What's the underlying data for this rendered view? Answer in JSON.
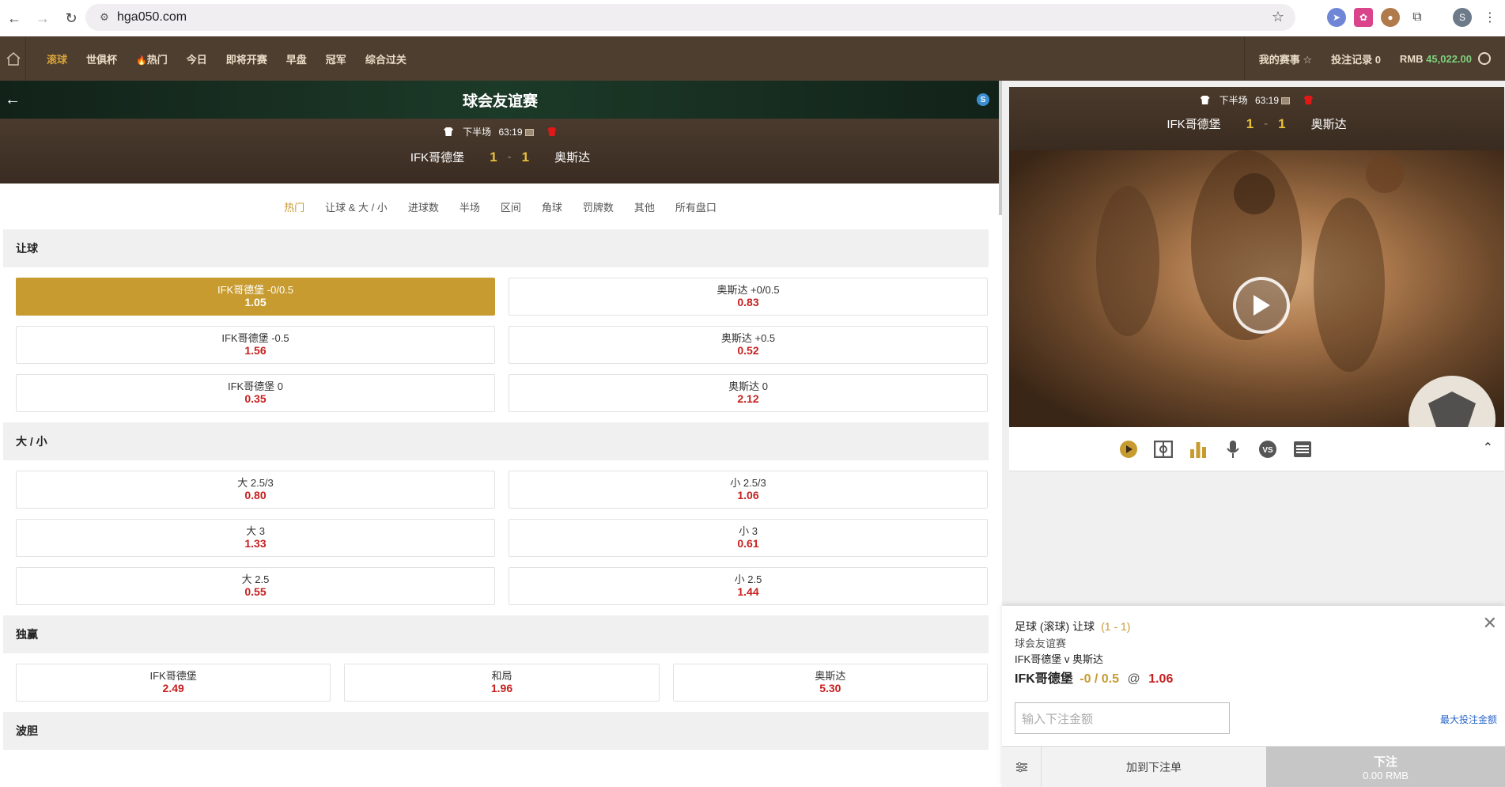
{
  "browser": {
    "url": "hga050.com",
    "profile_initial": "S"
  },
  "header": {
    "tabs": [
      {
        "label": "滚球",
        "active": true
      },
      {
        "label": "世俱杯"
      },
      {
        "label": "热门"
      },
      {
        "label": "今日"
      },
      {
        "label": "即将开赛"
      },
      {
        "label": "早盘"
      },
      {
        "label": "冠军"
      },
      {
        "label": "综合过关"
      }
    ],
    "my_events": "我的赛事",
    "bet_record": "投注记录 0",
    "currency": "RMB",
    "balance": "45,022.00"
  },
  "match": {
    "league": "球会友谊赛",
    "status": "下半场",
    "time": "63:19",
    "home": "IFK哥德堡",
    "away": "奥斯达",
    "home_score": "1",
    "away_score": "1",
    "separator": "-",
    "badge": "S"
  },
  "market_tabs": [
    "热门",
    "让球 & 大 / 小",
    "进球数",
    "半场",
    "区间",
    "角球",
    "罚牌数",
    "其他",
    "所有盘口"
  ],
  "sections": {
    "handicap": {
      "title": "让球",
      "rows": [
        [
          {
            "label": "IFK哥德堡 -0/0.5",
            "odds": "1.05",
            "selected": true
          },
          {
            "label": "奥斯达 +0/0.5",
            "odds": "0.83"
          }
        ],
        [
          {
            "label": "IFK哥德堡 -0.5",
            "odds": "1.56"
          },
          {
            "label": "奥斯达 +0.5",
            "odds": "0.52"
          }
        ],
        [
          {
            "label": "IFK哥德堡 0",
            "odds": "0.35"
          },
          {
            "label": "奥斯达 0",
            "odds": "2.12"
          }
        ]
      ]
    },
    "over_under": {
      "title": "大 / 小",
      "rows": [
        [
          {
            "label": "大 2.5/3",
            "odds": "0.80"
          },
          {
            "label": "小 2.5/3",
            "odds": "1.06"
          }
        ],
        [
          {
            "label": "大 3",
            "odds": "1.33"
          },
          {
            "label": "小 3",
            "odds": "0.61"
          }
        ],
        [
          {
            "label": "大 2.5",
            "odds": "0.55"
          },
          {
            "label": "小 2.5",
            "odds": "1.44"
          }
        ]
      ]
    },
    "moneyline": {
      "title": "独赢",
      "items": [
        {
          "label": "IFK哥德堡",
          "odds": "2.49"
        },
        {
          "label": "和局",
          "odds": "1.96"
        },
        {
          "label": "奥斯达",
          "odds": "5.30"
        }
      ]
    },
    "correct_score": {
      "title": "波胆"
    }
  },
  "bet_slip": {
    "market": "足球 (滚球) 让球",
    "score": "(1 - 1)",
    "league": "球会友谊赛",
    "fixture": "IFK哥德堡 v 奥斯达",
    "pick_team": "IFK哥德堡",
    "pick_handicap": "-0 / 0.5",
    "at": "@",
    "pick_odds": "1.06",
    "amount_placeholder": "输入下注金额",
    "max_bet": "最大投注金额",
    "add_to_slip": "加到下注单",
    "place_bet": "下注",
    "place_amount": "0.00 RMB"
  },
  "colors": {
    "nav_bg": "#4e3e30",
    "accent_gold": "#c79b2f",
    "odds_red": "#c62020",
    "balance_green": "#7ed07e"
  }
}
